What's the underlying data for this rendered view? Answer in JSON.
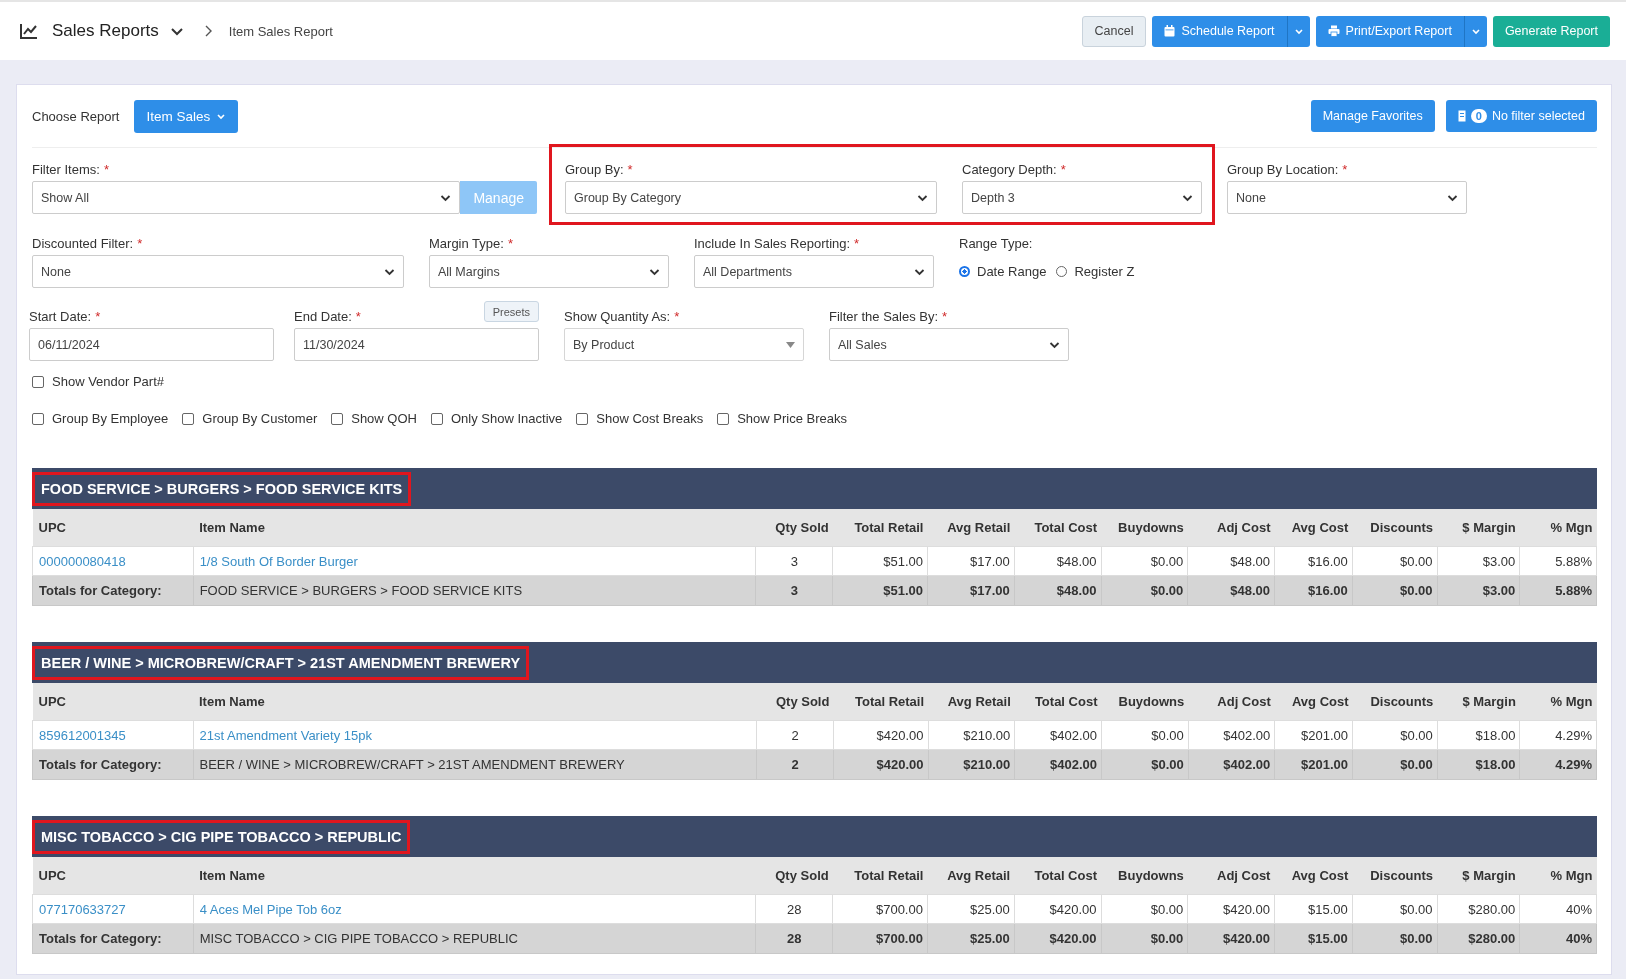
{
  "header": {
    "title": "Sales Reports",
    "breadcrumb": "Item Sales Report",
    "buttons": [
      {
        "label": "Cancel",
        "kind": "default"
      },
      {
        "label": "Schedule Report",
        "kind": "split"
      },
      {
        "label": "Print/Export Report",
        "kind": "split"
      },
      {
        "label": "Generate Report",
        "kind": "success"
      }
    ]
  },
  "report_bar": {
    "label": "Choose Report",
    "report": "Item Sales",
    "favorites": "Manage Favorites",
    "filter_count": "0",
    "filter_status": "No filter selected"
  },
  "filter_rows": [
    [
      {
        "kind": "select_button",
        "label": "Filter Items:",
        "required_mark": "*",
        "value": "Show All",
        "button": "Manage"
      },
      {
        "kind": "select",
        "label": "Group By:",
        "required_mark": "*",
        "value": "Group By Category",
        "highlighted": true
      },
      {
        "kind": "select",
        "label": "Category Depth:",
        "required_mark": "*",
        "value": "Depth 3",
        "highlighted": true
      },
      {
        "kind": "select",
        "label": "Group By Location:",
        "required_mark": "*",
        "value": "None"
      }
    ],
    [
      {
        "kind": "select",
        "label": "Discounted Filter:",
        "required_mark": "*",
        "value": "None"
      },
      {
        "kind": "select",
        "label": "Margin Type:",
        "required_mark": "*",
        "value": "All Margins"
      },
      {
        "kind": "select",
        "label": "Include In Sales Reporting:",
        "required_mark": "*",
        "value": "All Departments"
      },
      {
        "kind": "radio",
        "label": "Range Type:",
        "options": [
          {
            "label": "Date Range",
            "selected": true
          },
          {
            "label": "Register Z",
            "selected": false
          }
        ]
      }
    ],
    [
      {
        "kind": "date",
        "label": "Start Date:",
        "required_mark": "*",
        "value": "06/11/2024"
      },
      {
        "kind": "date",
        "label": "End Date:",
        "required_mark": "*",
        "value": "11/30/2024",
        "button": "Presets"
      },
      {
        "kind": "combo",
        "label": "Show Quantity As:",
        "required_mark": "*",
        "value": "By Product"
      },
      {
        "kind": "select",
        "label": "Filter the Sales By:",
        "required_mark": "*",
        "value": "All Sales"
      }
    ]
  ],
  "options": [
    [
      {
        "label": "Show Vendor Part#",
        "checked": false
      }
    ],
    [
      {
        "label": "Group By Employee",
        "checked": false
      },
      {
        "label": "Group By Customer",
        "checked": false
      },
      {
        "label": "Show QOH",
        "checked": false
      },
      {
        "label": "Only Show Inactive",
        "checked": false
      },
      {
        "label": "Show Cost Breaks",
        "checked": false
      },
      {
        "label": "Show Price Breaks",
        "checked": false
      }
    ]
  ],
  "sections": [
    {
      "title": "FOOD SERVICE > BURGERS > FOOD SERVICE KITS",
      "highlighted": true,
      "columns": [
        "UPC",
        "Item Name",
        "Qty Sold",
        "Total Retail",
        "Avg Retail",
        "Total Cost",
        "Buydowns",
        "Adj Cost",
        "Avg Cost",
        "Discounts",
        "$ Margin",
        "% Mgn"
      ],
      "rows": [
        {
          "cells": [
            "000000080418",
            "1/8 South Of Border Burger",
            "3",
            "$51.00",
            "$17.00",
            "$48.00",
            "$0.00",
            "$48.00",
            "$16.00",
            "$0.00",
            "$3.00",
            "5.88%"
          ]
        }
      ],
      "totals": [
        "Totals for Category:",
        "FOOD SERVICE > BURGERS > FOOD SERVICE KITS",
        "3",
        "$51.00",
        "$17.00",
        "$48.00",
        "$0.00",
        "$48.00",
        "$16.00",
        "$0.00",
        "$3.00",
        "5.88%"
      ]
    },
    {
      "title": "BEER / WINE > MICROBREW/CRAFT > 21ST AMENDMENT BREWERY",
      "highlighted": true,
      "columns": [
        "UPC",
        "Item Name",
        "Qty Sold",
        "Total Retail",
        "Avg Retail",
        "Total Cost",
        "Buydowns",
        "Adj Cost",
        "Avg Cost",
        "Discounts",
        "$ Margin",
        "% Mgn"
      ],
      "rows": [
        {
          "cells": [
            "859612001345",
            "21st Amendment Variety 15pk",
            "2",
            "$420.00",
            "$210.00",
            "$402.00",
            "$0.00",
            "$402.00",
            "$201.00",
            "$0.00",
            "$18.00",
            "4.29%"
          ]
        }
      ],
      "totals": [
        "Totals for Category:",
        "BEER / WINE > MICROBREW/CRAFT > 21ST AMENDMENT BREWERY",
        "2",
        "$420.00",
        "$210.00",
        "$402.00",
        "$0.00",
        "$402.00",
        "$201.00",
        "$0.00",
        "$18.00",
        "4.29%"
      ]
    },
    {
      "title": "MISC TOBACCO > CIG PIPE TOBACCO > REPUBLIC",
      "highlighted": true,
      "columns": [
        "UPC",
        "Item Name",
        "Qty Sold",
        "Total Retail",
        "Avg Retail",
        "Total Cost",
        "Buydowns",
        "Adj Cost",
        "Avg Cost",
        "Discounts",
        "$ Margin",
        "% Mgn"
      ],
      "rows": [
        {
          "cells": [
            "077170633727",
            "4 Aces Mel Pipe Tob 6oz",
            "28",
            "$700.00",
            "$25.00",
            "$420.00",
            "$0.00",
            "$420.00",
            "$15.00",
            "$0.00",
            "$280.00",
            "40%"
          ]
        }
      ],
      "totals": [
        "Totals for Category:",
        "MISC TOBACCO > CIG PIPE TOBACCO > REPUBLIC",
        "28",
        "$700.00",
        "$25.00",
        "$420.00",
        "$0.00",
        "$420.00",
        "$15.00",
        "$0.00",
        "$280.00",
        "40%"
      ]
    }
  ]
}
